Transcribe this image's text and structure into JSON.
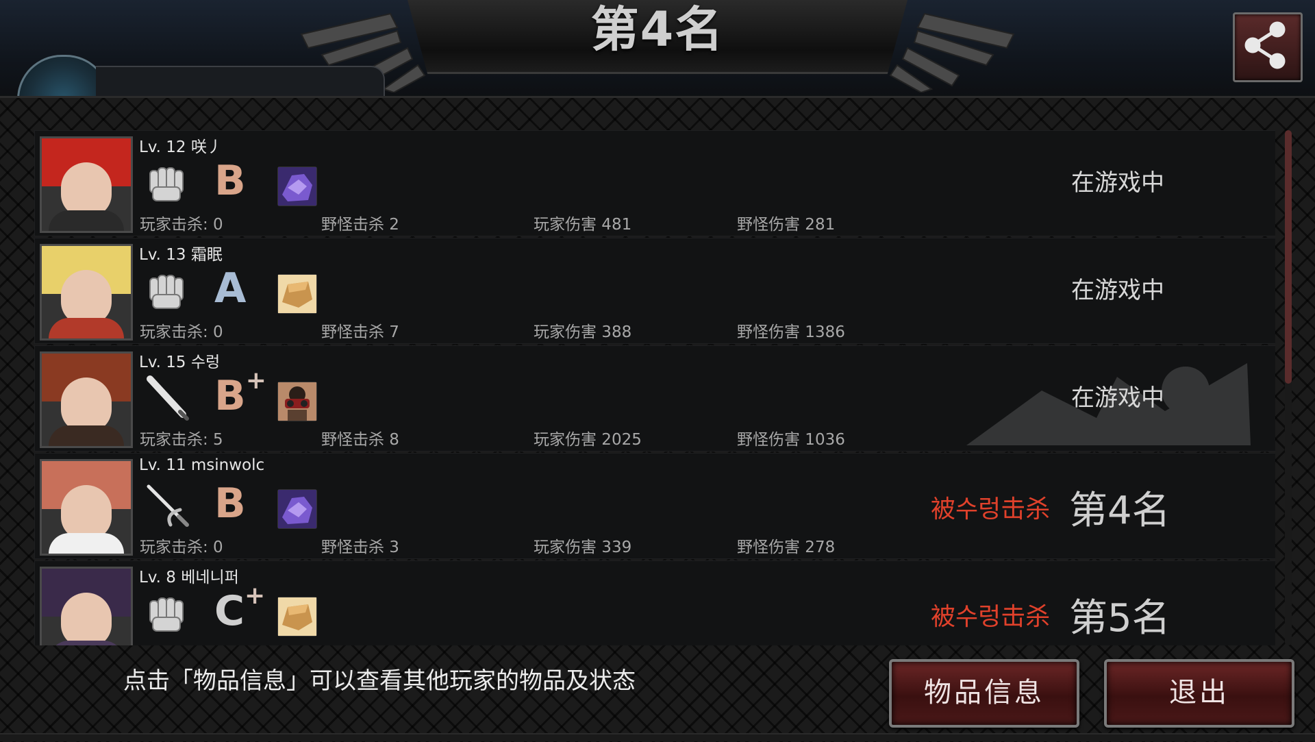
{
  "header": {
    "title": "第4名"
  },
  "players": [
    {
      "level": "Lv. 12",
      "name": "咲丿",
      "grade": "B",
      "grade_plus": "",
      "grade_color": "#d9a58a",
      "weapon": "fist-icon",
      "item": "purple-armor-icon",
      "player_kills": "玩家击杀: 0",
      "monster_kills": "野怪击杀 2",
      "player_damage": "玩家伤害 481",
      "monster_damage": "野怪伤害 281",
      "status": "在游戏中",
      "killed_by": "",
      "rank": "",
      "hair_color": "#c4261e",
      "body_color": "#2a2a2a"
    },
    {
      "level": "Lv. 13",
      "name": "霜眠",
      "grade": "A",
      "grade_plus": "",
      "grade_color": "#a8bcd4",
      "weapon": "fist-icon",
      "item": "bread-icon",
      "player_kills": "玩家击杀: 0",
      "monster_kills": "野怪击杀 7",
      "player_damage": "玩家伤害 388",
      "monster_damage": "野怪伤害 1386",
      "status": "在游戏中",
      "killed_by": "",
      "rank": "",
      "hair_color": "#e8d06a",
      "body_color": "#b23a2a"
    },
    {
      "level": "Lv. 15",
      "name": "수렁",
      "grade": "B",
      "grade_plus": "+",
      "grade_color": "#d9a58a",
      "weapon": "bat-icon",
      "item": "binoculars-icon",
      "player_kills": "玩家击杀: 5",
      "monster_kills": "野怪击杀 8",
      "player_damage": "玩家伤害 2025",
      "monster_damage": "野怪伤害 1036",
      "status": "在游戏中",
      "killed_by": "",
      "rank": "",
      "hair_color": "#8a3a22",
      "body_color": "#3a2a22"
    },
    {
      "level": "Lv. 11",
      "name": "msinwolc",
      "grade": "B",
      "grade_plus": "",
      "grade_color": "#d9a58a",
      "weapon": "rapier-icon",
      "item": "purple-armor-icon",
      "player_kills": "玩家击杀: 0",
      "monster_kills": "野怪击杀 3",
      "player_damage": "玩家伤害 339",
      "monster_damage": "野怪伤害 278",
      "status": "",
      "killed_by": "被수렁击杀",
      "rank": "第4名",
      "hair_color": "#c8705a",
      "body_color": "#f0f0f0"
    },
    {
      "level": "Lv. 8",
      "name": "베네니퍼",
      "grade": "C",
      "grade_plus": "+",
      "grade_color": "#cfcfcf",
      "weapon": "fist-icon",
      "item": "bread-icon",
      "player_kills": "",
      "monster_kills": "",
      "player_damage": "",
      "monster_damage": "",
      "status": "",
      "killed_by": "被수렁击杀",
      "rank": "第5名",
      "hair_color": "#3a2a4a",
      "body_color": "#4a3a5a"
    }
  ],
  "footer": {
    "hint": "点击「物品信息」可以查看其他玩家的物品及状态",
    "items_button": "物品信息",
    "quit_button": "退出"
  }
}
